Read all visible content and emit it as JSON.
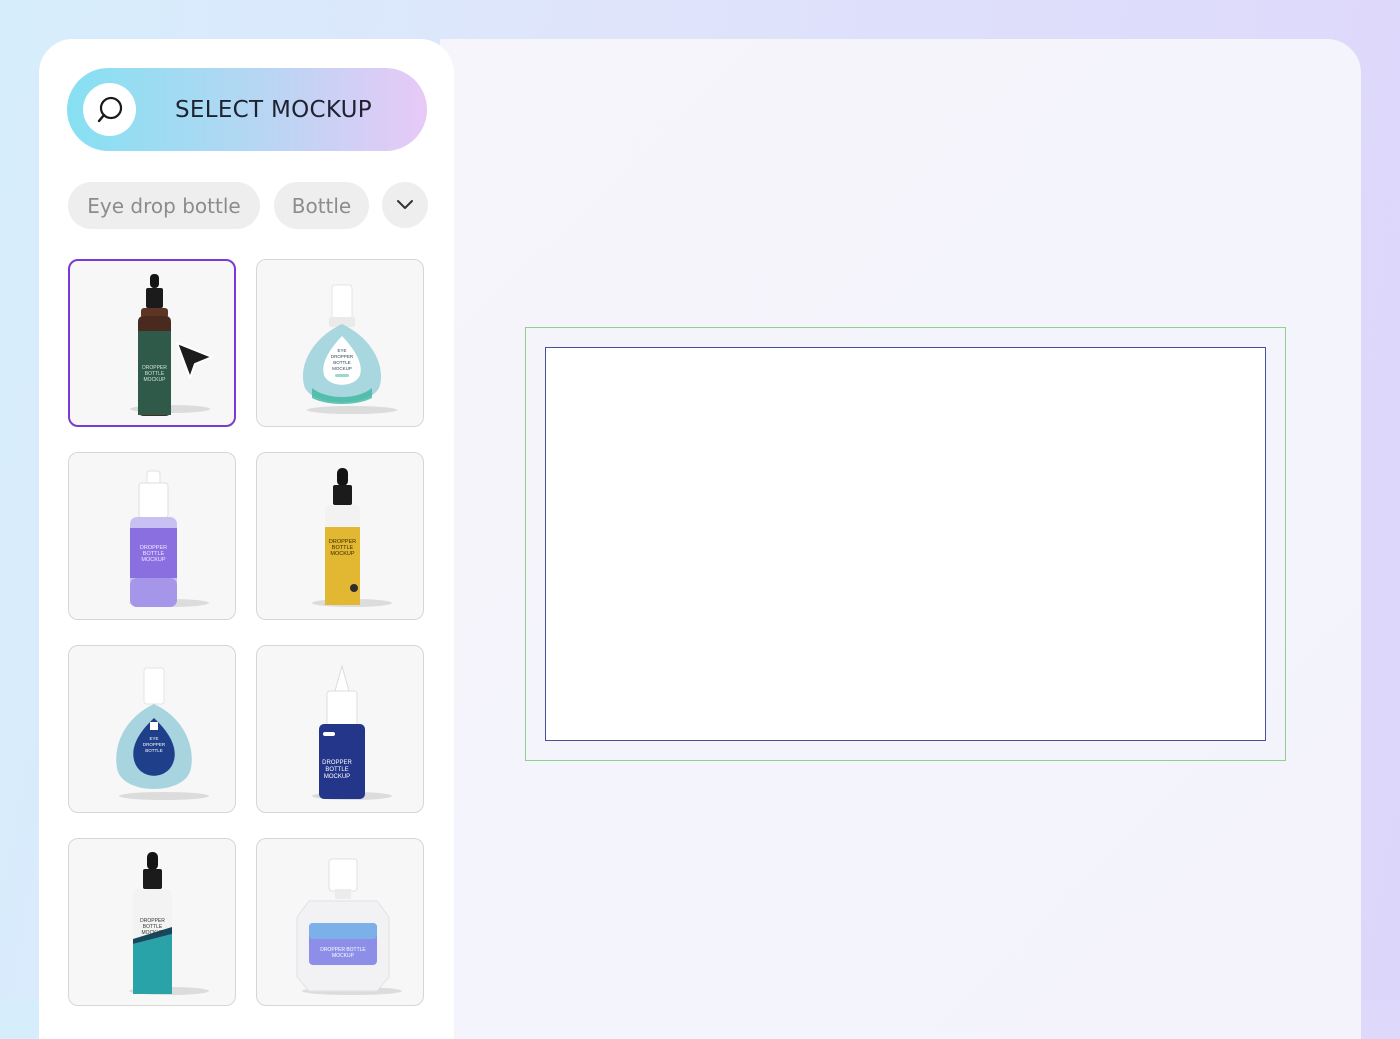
{
  "search": {
    "button_label": "SELECT MOCKUP",
    "icon": "search-icon"
  },
  "filters": {
    "chips": [
      "Eye drop bottle",
      "Bottle"
    ],
    "more_icon": "chevron-down-icon"
  },
  "mockups": [
    {
      "label_text": "DROPPER BOTTLE MOCKUP",
      "selected": true,
      "color": "#2f5a4a"
    },
    {
      "label_text": "EYE DROPPER BOTTLE MOCKUP",
      "selected": false,
      "color": "#9fd3db"
    },
    {
      "label_text": "DROPPER BOTTLE MOCKUP",
      "selected": false,
      "color": "#8a6fe0"
    },
    {
      "label_text": "DROPPER BOTTLE MOCKUP",
      "selected": false,
      "color": "#e2b732"
    },
    {
      "label_text": "EYE DROPPER BOTTLE",
      "selected": false,
      "color": "#a8d4e0"
    },
    {
      "label_text": "DROPPER BOTTLE MOCKUP",
      "selected": false,
      "color": "#24368a"
    },
    {
      "label_text": "DROPPER BOTTLE MOCKUP",
      "selected": false,
      "color": "#2aa3a8"
    },
    {
      "label_text": "DROPPER BOTTLE MOCKUP",
      "selected": false,
      "color": "#8d8ee8"
    }
  ],
  "colors": {
    "selection": "#7b3ad6",
    "canvas_outer": "#8fd08a",
    "canvas_inner": "#4a4f9a"
  }
}
